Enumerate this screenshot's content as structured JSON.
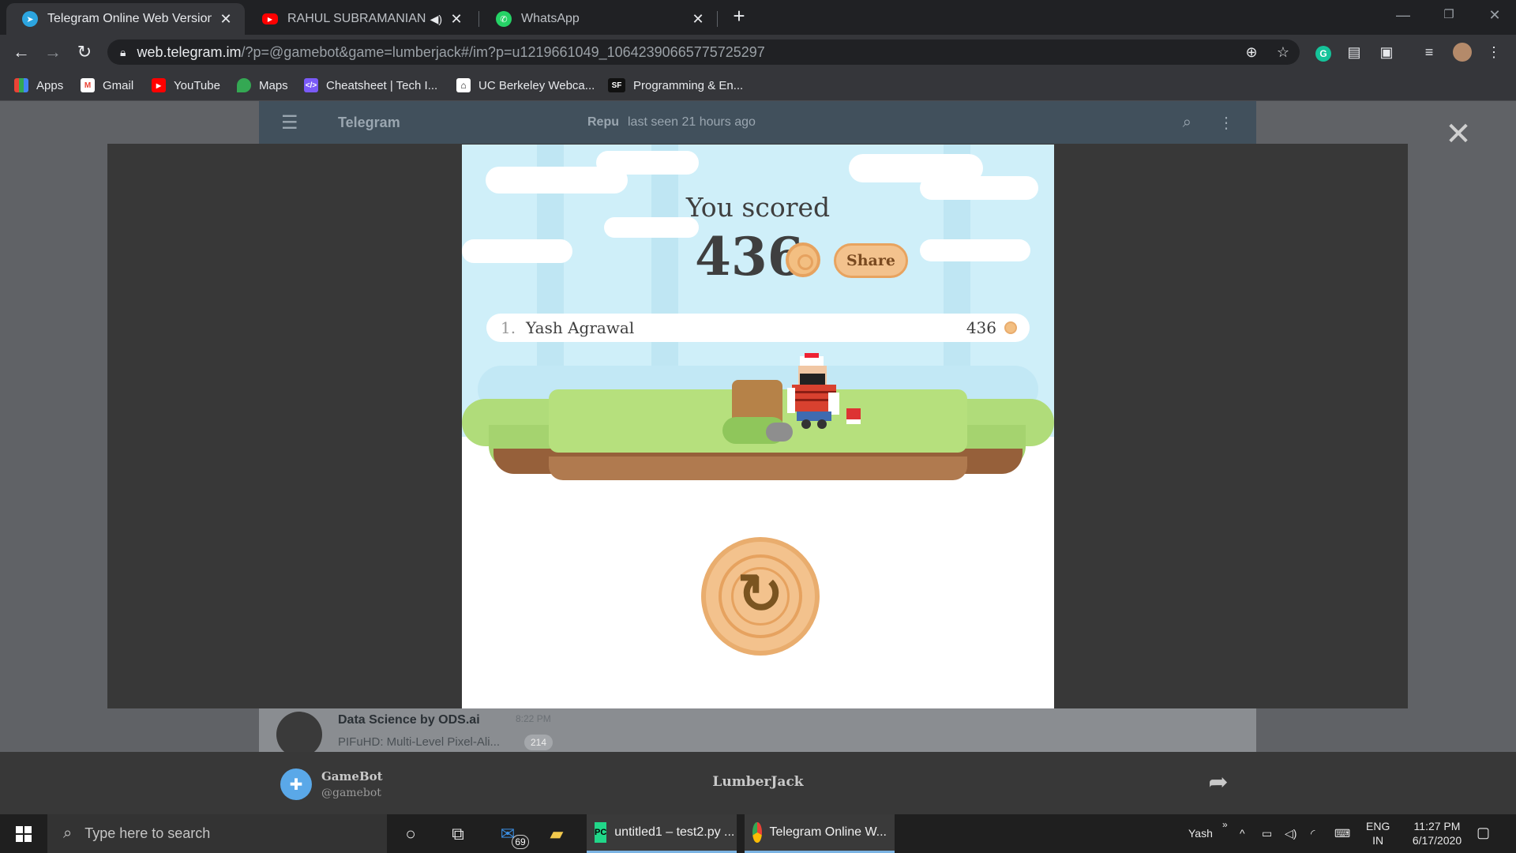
{
  "browser": {
    "tabs": [
      {
        "title": "Telegram Online Web Version",
        "icon": "telegram-icon",
        "active": true
      },
      {
        "title": "RAHUL SUBRAMANIAN - LIV",
        "icon": "youtube-icon",
        "active": false
      },
      {
        "title": "WhatsApp",
        "icon": "whatsapp-icon",
        "active": false
      }
    ],
    "url_host": "web.telegram.im",
    "url_path": "/?p=@gamebot&game=lumberjack#/im?p=u1219661049_10642390665775725297",
    "bookmarks": [
      {
        "label": "Apps",
        "icon": "apps-grid-icon"
      },
      {
        "label": "Gmail",
        "icon": "gmail-icon"
      },
      {
        "label": "YouTube",
        "icon": "youtube-icon"
      },
      {
        "label": "Maps",
        "icon": "maps-icon"
      },
      {
        "label": "Cheatsheet | Tech I...",
        "icon": "code-icon"
      },
      {
        "label": "UC Berkeley Webca...",
        "icon": "university-icon"
      },
      {
        "label": "Programming & En...",
        "icon": "sf-icon"
      }
    ]
  },
  "telegram": {
    "app_name": "Telegram",
    "peer_name": "Repu",
    "peer_status": "last seen 21 hours ago",
    "chat_item": {
      "name": "Data Science by ODS.ai",
      "time": "8:22 PM",
      "preview": "PIFuHD: Multi-Level Pixel-Ali...",
      "unread": "214"
    }
  },
  "game": {
    "score_label": "You scored",
    "score": "436",
    "share_label": "Share",
    "leaderboard": [
      {
        "rank": "1.",
        "name": "Yash Agrawal",
        "score": "436"
      }
    ],
    "bot_name": "GameBot",
    "bot_username": "@gamebot",
    "title": "LumberJack"
  },
  "taskbar": {
    "search_placeholder": "Type here to search",
    "mail_badge": "69",
    "apps": [
      {
        "label": "untitled1 – test2.py ...",
        "icon": "pycharm-icon"
      },
      {
        "label": "Telegram Online W...",
        "icon": "chrome-icon"
      }
    ],
    "user": "Yash",
    "lang": "ENG",
    "region": "IN",
    "time": "11:27 PM",
    "date": "6/17/2020"
  },
  "colors": {
    "sky": "#cfeff9",
    "grass": "#b0dc7a",
    "wood": "#f3c28d",
    "accent_blue": "#7ab3e3"
  }
}
